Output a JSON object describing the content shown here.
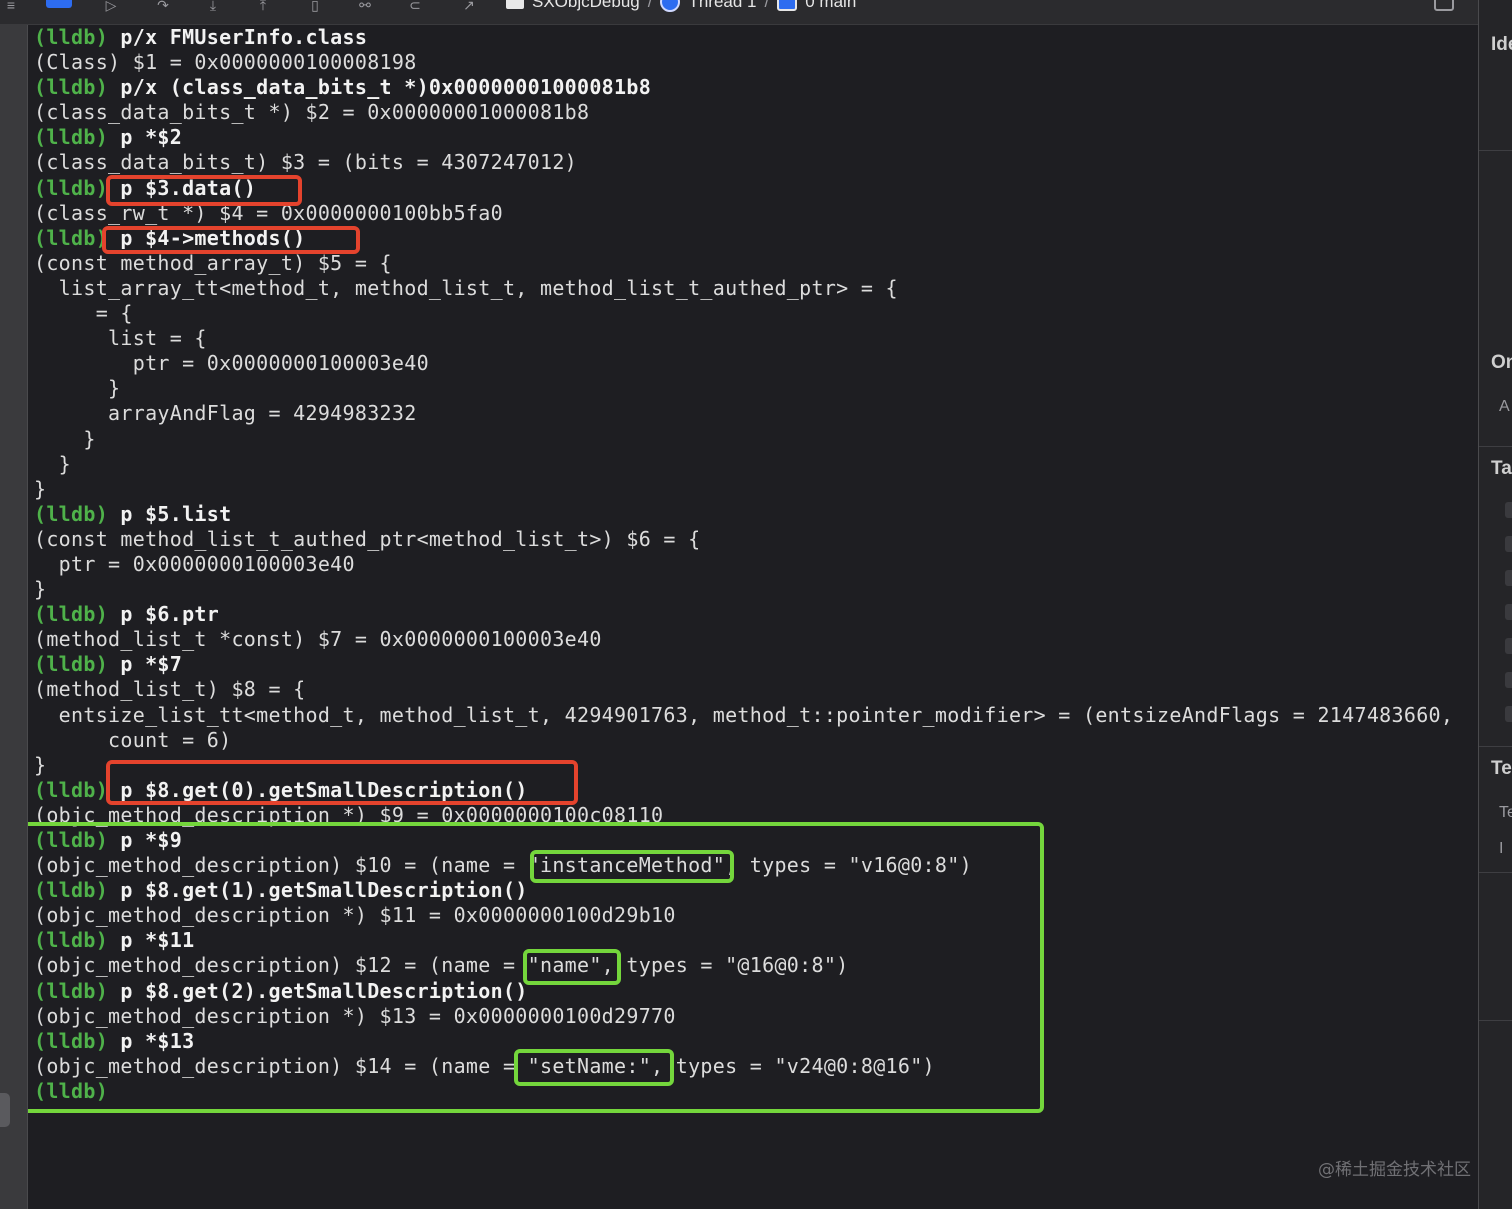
{
  "topbar": {
    "left_edge_glyph": "≡",
    "breadcrumb": {
      "scheme": "SXObjcDebug",
      "thread": "Thread 1",
      "frame": "0 main"
    }
  },
  "console": {
    "lines": [
      {
        "prompt": "(lldb)",
        "text": " p/x FMUserInfo.class"
      },
      {
        "prompt": "",
        "text": "(Class) $1 = 0x0000000100008198"
      },
      {
        "prompt": "(lldb)",
        "text": " p/x (class_data_bits_t *)0x00000001000081b8"
      },
      {
        "prompt": "",
        "text": "(class_data_bits_t *) $2 = 0x00000001000081b8"
      },
      {
        "prompt": "(lldb)",
        "text": " p *$2"
      },
      {
        "prompt": "",
        "text": "(class_data_bits_t) $3 = (bits = 4307247012)"
      },
      {
        "prompt": "(lldb)",
        "text": " p $3.data()"
      },
      {
        "prompt": "",
        "text": "(class_rw_t *) $4 = 0x0000000100bb5fa0"
      },
      {
        "prompt": "(lldb)",
        "text": " p $4->methods()"
      },
      {
        "prompt": "",
        "text": "(const method_array_t) $5 = {"
      },
      {
        "prompt": "",
        "text": "  list_array_tt<method_t, method_list_t, method_list_t_authed_ptr> = {"
      },
      {
        "prompt": "",
        "text": "     = {"
      },
      {
        "prompt": "",
        "text": "      list = {"
      },
      {
        "prompt": "",
        "text": "        ptr = 0x0000000100003e40"
      },
      {
        "prompt": "",
        "text": "      }"
      },
      {
        "prompt": "",
        "text": "      arrayAndFlag = 4294983232"
      },
      {
        "prompt": "",
        "text": "    }"
      },
      {
        "prompt": "",
        "text": "  }"
      },
      {
        "prompt": "",
        "text": "}"
      },
      {
        "prompt": "(lldb)",
        "text": " p $5.list"
      },
      {
        "prompt": "",
        "text": "(const method_list_t_authed_ptr<method_list_t>) $6 = {"
      },
      {
        "prompt": "",
        "text": "  ptr = 0x0000000100003e40"
      },
      {
        "prompt": "",
        "text": "}"
      },
      {
        "prompt": "(lldb)",
        "text": " p $6.ptr"
      },
      {
        "prompt": "",
        "text": "(method_list_t *const) $7 = 0x0000000100003e40"
      },
      {
        "prompt": "(lldb)",
        "text": " p *$7"
      },
      {
        "prompt": "",
        "text": "(method_list_t) $8 = {"
      },
      {
        "prompt": "",
        "text": "  entsize_list_tt<method_t, method_list_t, 4294901763, method_t::pointer_modifier> = (entsizeAndFlags = 2147483660,"
      },
      {
        "prompt": "",
        "text": "      count = 6)"
      },
      {
        "prompt": "",
        "text": "}"
      },
      {
        "prompt": "(lldb)",
        "text": " p $8.get(0).getSmallDescription()"
      },
      {
        "prompt": "",
        "text": "(objc_method_description *) $9 = 0x0000000100c08110"
      },
      {
        "prompt": "(lldb)",
        "text": " p *$9"
      },
      {
        "prompt": "",
        "text": "(objc_method_description) $10 = (name = \"instanceMethod\", types = \"v16@0:8\")"
      },
      {
        "prompt": "(lldb)",
        "text": " p $8.get(1).getSmallDescription()"
      },
      {
        "prompt": "",
        "text": "(objc_method_description *) $11 = 0x0000000100d29b10"
      },
      {
        "prompt": "(lldb)",
        "text": " p *$11"
      },
      {
        "prompt": "",
        "text": "(objc_method_description) $12 = (name = \"name\", types = \"@16@0:8\")"
      },
      {
        "prompt": "(lldb)",
        "text": " p $8.get(2).getSmallDescription()"
      },
      {
        "prompt": "",
        "text": "(objc_method_description *) $13 = 0x0000000100d29770"
      },
      {
        "prompt": "(lldb)",
        "text": " p *$13"
      },
      {
        "prompt": "",
        "text": "(objc_method_description) $14 = (name = \"setName:\", types = \"v24@0:8@16\")"
      },
      {
        "prompt": "(lldb)",
        "text": ""
      }
    ],
    "colors": {
      "prompt": "#4fb24a",
      "text": "#f2f2f2",
      "red_highlight": "#e4432d",
      "green_highlight": "#74d63c"
    }
  },
  "inspector": {
    "sections": [
      "Ide",
      "On",
      "Ta",
      "Te"
    ],
    "subs": [
      "A",
      "Te",
      "I"
    ]
  },
  "watermark": "@稀土掘金技术社区"
}
